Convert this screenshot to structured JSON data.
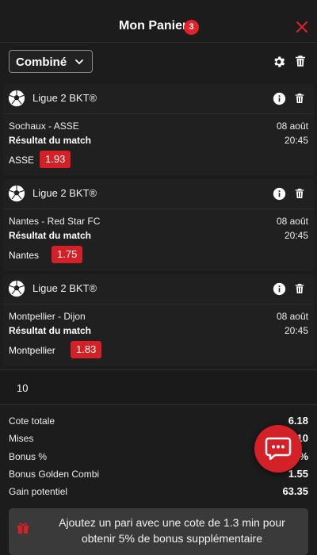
{
  "header": {
    "title": "Mon Panier",
    "count": "3"
  },
  "toolbar": {
    "mode": "Combiné"
  },
  "bets": [
    {
      "league": "Ligue 2 BKT®",
      "match": "Sochaux - ASSE",
      "date": "08 août",
      "market": "Résultat du match",
      "time": "20:45",
      "selection": "ASSE",
      "odd": "1.93"
    },
    {
      "league": "Ligue 2 BKT®",
      "match": "Nantes - Red Star FC",
      "date": "08 août",
      "market": "Résultat du match",
      "time": "20:45",
      "selection": "Nantes",
      "odd": "1.75"
    },
    {
      "league": "Ligue 2 BKT®",
      "match": "Montpellier - Dijon",
      "date": "08 août",
      "market": "Résultat du match",
      "time": "20:45",
      "selection": "Montpellier",
      "odd": "1.83"
    }
  ],
  "stake": {
    "value": "10"
  },
  "summary": [
    {
      "label": "Cote totale",
      "value": "6.18"
    },
    {
      "label": "Mises",
      "value": "10"
    },
    {
      "label": "Bonus %",
      "value": "%"
    },
    {
      "label": "Bonus Golden Combi",
      "value": "1.55"
    },
    {
      "label": "Gain potentiel",
      "value": "63.35"
    }
  ],
  "promo": {
    "text": "Ajoutez un pari avec une cote de 1.3 min pour obtenir 5% de bonus supplémentaire"
  },
  "colors": {
    "accent": "#d42127",
    "background": "#1c1c1c",
    "card": "#202020"
  },
  "icons": [
    "close-icon",
    "chevron-down-icon",
    "gear-icon",
    "trash-icon",
    "soccer-ball-icon",
    "info-icon",
    "chat-icon",
    "gift-icon"
  ]
}
